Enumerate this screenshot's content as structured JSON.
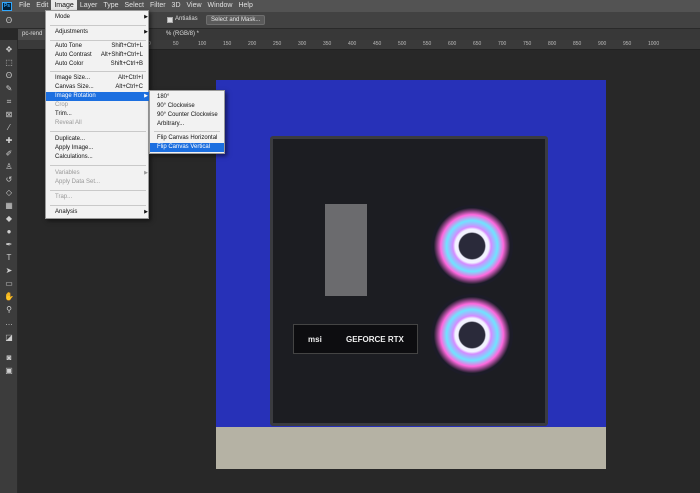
{
  "menubar": {
    "logo": "Ps",
    "items": [
      "File",
      "Edit",
      "Image",
      "Layer",
      "Type",
      "Select",
      "Filter",
      "3D",
      "View",
      "Window",
      "Help"
    ]
  },
  "options": {
    "antialias_label": "Antialias",
    "select_mask_label": "Select and Mask..."
  },
  "document": {
    "tab_name": "pc-rend",
    "tab_info": "% (RGB/8) *"
  },
  "ruler": [
    "0",
    "50",
    "100",
    "150",
    "200",
    "250",
    "300",
    "350",
    "400",
    "450",
    "500",
    "550",
    "600",
    "650",
    "700",
    "750",
    "800",
    "850",
    "900",
    "950",
    "1000"
  ],
  "image_menu": {
    "mode": "Mode",
    "adjustments": "Adjustments",
    "auto_tone": "Auto Tone",
    "auto_tone_sc": "Shift+Ctrl+L",
    "auto_contrast": "Auto Contrast",
    "auto_contrast_sc": "Alt+Shift+Ctrl+L",
    "auto_color": "Auto Color",
    "auto_color_sc": "Shift+Ctrl+B",
    "image_size": "Image Size...",
    "image_size_sc": "Alt+Ctrl+I",
    "canvas_size": "Canvas Size...",
    "canvas_size_sc": "Alt+Ctrl+C",
    "image_rotation": "Image Rotation",
    "crop": "Crop",
    "trim": "Trim...",
    "reveal_all": "Reveal All",
    "duplicate": "Duplicate...",
    "apply_image": "Apply Image...",
    "calculations": "Calculations...",
    "variables": "Variables",
    "apply_data_set": "Apply Data Set...",
    "trap": "Trap...",
    "analysis": "Analysis"
  },
  "rotation_submenu": {
    "r180": "180°",
    "r90cw": "90° Clockwise",
    "r90ccw": "90° Counter Clockwise",
    "arbitrary": "Arbitrary...",
    "flip_h": "Flip Canvas Horizontal",
    "flip_v": "Flip Canvas Vertical"
  },
  "photo": {
    "gpu_brand": "msi",
    "gpu_model": "GEFORCE RTX"
  },
  "colors": {
    "menubar": "#535353",
    "highlight": "#1c6fe0",
    "canvas_bg": "#2731b8"
  }
}
